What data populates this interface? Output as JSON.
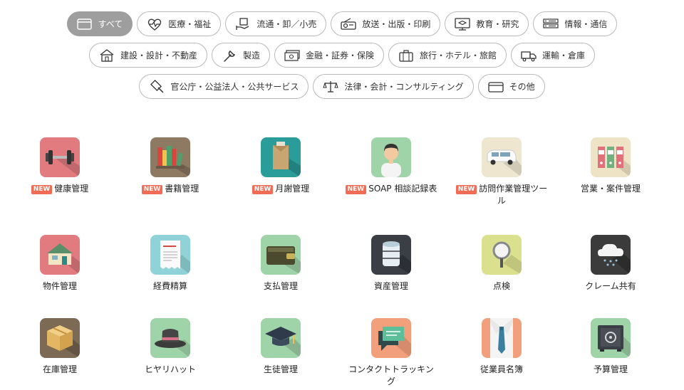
{
  "filters": {
    "row1": [
      {
        "label": "すべて",
        "icon": "cards-icon",
        "active": true
      },
      {
        "label": "医療・福祉",
        "icon": "heart-pulse-icon"
      },
      {
        "label": "流通・卸／小売",
        "icon": "box-hand-icon"
      },
      {
        "label": "放送・出版・印刷",
        "icon": "radio-icon"
      },
      {
        "label": "教育・研究",
        "icon": "graduation-monitor-icon"
      },
      {
        "label": "情報・通信",
        "icon": "server-icon"
      }
    ],
    "row2": [
      {
        "label": "建設・設計・不動産",
        "icon": "house-icon"
      },
      {
        "label": "製造",
        "icon": "wrench-icon"
      },
      {
        "label": "金融・証券・保険",
        "icon": "money-icon"
      },
      {
        "label": "旅行・ホテル・旅館",
        "icon": "suitcase-icon"
      },
      {
        "label": "運輸・倉庫",
        "icon": "truck-icon"
      }
    ],
    "row3": [
      {
        "label": "官公庁・公益法人・公共サービス",
        "icon": "gavel-icon"
      },
      {
        "label": "法律・会計・コンサルティング",
        "icon": "scales-icon"
      },
      {
        "label": "その他",
        "icon": "wallet-icon"
      }
    ]
  },
  "apps": [
    {
      "name": "健康管理",
      "badge": "NEW",
      "icon": "dumbbell-icon",
      "color": "#e27b7f"
    },
    {
      "name": "書籍管理",
      "badge": "NEW",
      "icon": "books-icon",
      "color": "#8e7a63"
    },
    {
      "name": "月謝管理",
      "badge": "NEW",
      "icon": "envelope-icon",
      "color": "#2a9d9a"
    },
    {
      "name": "SOAP 相談記録表",
      "badge": "NEW",
      "icon": "person-icon",
      "color": "#9fd3a8"
    },
    {
      "name": "訪問作業管理ツール",
      "badge": "NEW",
      "icon": "van-icon",
      "color": "#eee6cf"
    },
    {
      "name": "営業・案件管理",
      "badge": "",
      "icon": "binders-icon",
      "color": "#efe3c5"
    },
    {
      "name": "物件管理",
      "badge": "",
      "icon": "house-icon",
      "color": "#e27b7f"
    },
    {
      "name": "経費精算",
      "badge": "",
      "icon": "receipt-icon",
      "color": "#8fd3d8"
    },
    {
      "name": "支払管理",
      "badge": "",
      "icon": "wallet-icon",
      "color": "#9fd3a8"
    },
    {
      "name": "資産管理",
      "badge": "",
      "icon": "database-icon",
      "color": "#3b3f45"
    },
    {
      "name": "点検",
      "badge": "",
      "icon": "magnifier-icon",
      "color": "#dbe08f"
    },
    {
      "name": "クレーム共有",
      "badge": "",
      "icon": "cloud-rain-icon",
      "color": "#3b3b3b"
    },
    {
      "name": "在庫管理",
      "badge": "",
      "icon": "cardboard-box-icon",
      "color": "#7d6a55"
    },
    {
      "name": "ヒヤリハット",
      "badge": "",
      "icon": "hat-icon",
      "color": "#9fd3a8"
    },
    {
      "name": "生徒管理",
      "badge": "",
      "icon": "mortarboard-icon",
      "color": "#9fd3a8"
    },
    {
      "name": "コンタクトトラッキング",
      "badge": "",
      "icon": "chat-bubble-icon",
      "color": "#f2a07b"
    },
    {
      "name": "従業員名簿",
      "badge": "",
      "icon": "shirt-tie-icon",
      "color": "#f2a07b"
    },
    {
      "name": "予算管理",
      "badge": "",
      "icon": "safe-icon",
      "color": "#9fd3a8"
    }
  ]
}
